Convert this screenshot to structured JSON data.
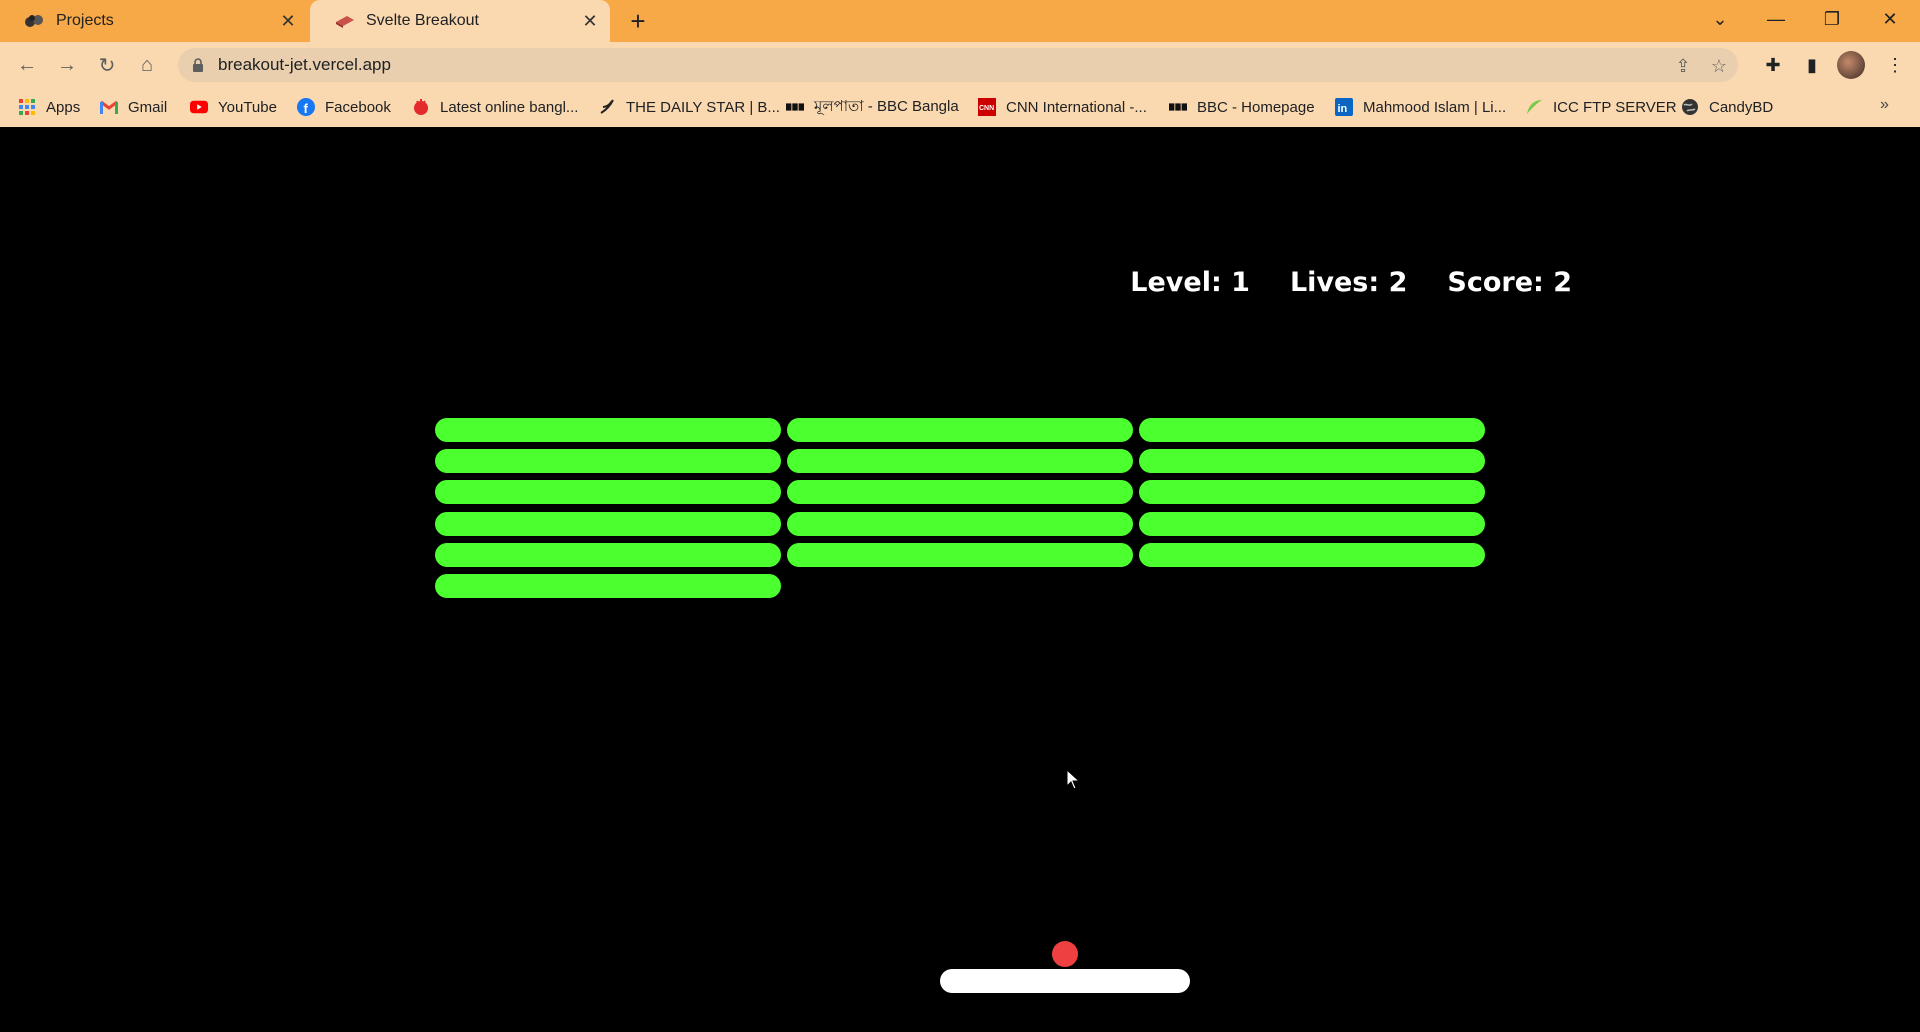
{
  "browser": {
    "tabs": [
      {
        "title": "Projects",
        "icon": "projects-favicon"
      },
      {
        "title": "Svelte Breakout",
        "icon": "brick-favicon"
      }
    ],
    "url": "breakout-jet.vercel.app",
    "bookmarks": [
      {
        "label": "Apps",
        "icon": "apps-grid-icon"
      },
      {
        "label": "Gmail",
        "icon": "gmail-icon"
      },
      {
        "label": "YouTube",
        "icon": "youtube-icon"
      },
      {
        "label": "Facebook",
        "icon": "facebook-icon"
      },
      {
        "label": "Latest online bangl...",
        "icon": "news-icon"
      },
      {
        "label": "THE DAILY STAR | B...",
        "icon": "daily-star-icon"
      },
      {
        "label": "মূলপাতা - BBC Bangla",
        "icon": "bbc-icon"
      },
      {
        "label": "CNN International -...",
        "icon": "cnn-icon"
      },
      {
        "label": "BBC - Homepage",
        "icon": "bbc-icon"
      },
      {
        "label": "Mahmood Islam | Li...",
        "icon": "linkedin-icon"
      },
      {
        "label": "ICC FTP SERVER",
        "icon": "leaf-icon"
      },
      {
        "label": "CandyBD",
        "icon": "globe-icon"
      }
    ]
  },
  "game": {
    "hud": {
      "level": "Level: 1",
      "lives": "Lives: 2",
      "score": "Score: 2"
    },
    "brick_color": "#4cff2e",
    "ball_color": "#ee4040",
    "paddle_color": "#ffffff",
    "bricks": {
      "columns": 3,
      "rows": 6,
      "present": [
        [
          1,
          1,
          1
        ],
        [
          1,
          1,
          1
        ],
        [
          1,
          1,
          1
        ],
        [
          1,
          1,
          1
        ],
        [
          1,
          1,
          1
        ],
        [
          1,
          0,
          0
        ]
      ]
    }
  }
}
